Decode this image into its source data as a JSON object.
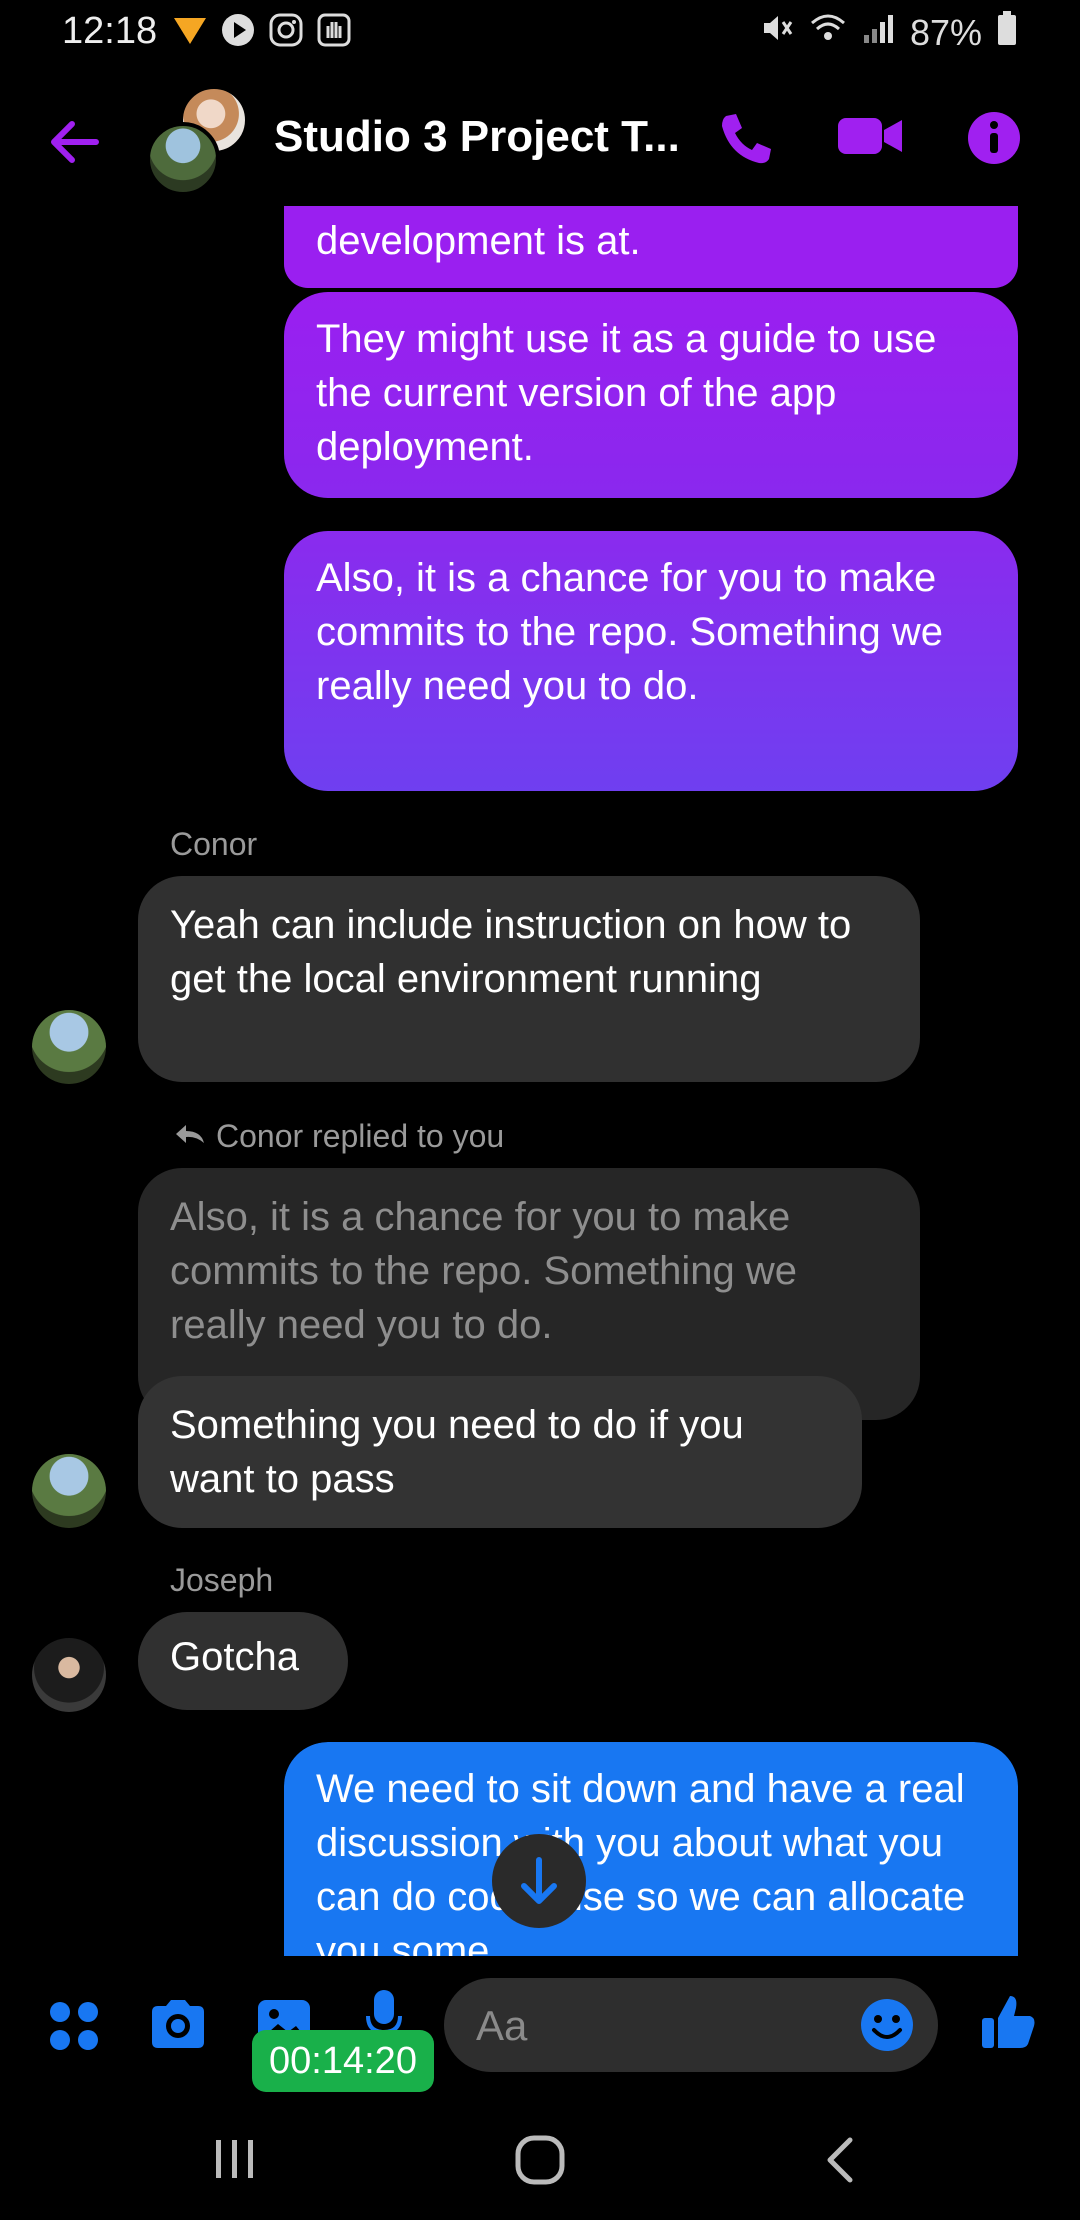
{
  "status_bar": {
    "time": "12:18",
    "battery": "87%"
  },
  "header": {
    "title": "Studio 3 Project T..."
  },
  "colors": {
    "accent_purple": "#9a1ff0",
    "accent_blue": "#1877f2",
    "received_bubble": "#303030",
    "timer_green": "#19b04a"
  },
  "messages": {
    "m1": "development is at.",
    "m2": "They might use it as a guide to use the current version of the app deployment.",
    "m3": "Also, it is a chance for you to make commits to the repo. Something we really need you to do.",
    "sender_conor": "Conor",
    "m4": "Yeah can include instruction on how to get the local environment running",
    "reply_label": "Conor replied to you",
    "quoted": "Also, it is a chance for you to make commits to the repo. Something we really need you to do.",
    "m5": "Something you need to do if you want to pass",
    "sender_joseph": "Joseph",
    "m6": "Gotcha",
    "m7": "We need to sit down and have a real discussion with you about what you can do code wise so we can allocate you some"
  },
  "composer": {
    "placeholder": "Aa",
    "timer": "00:14:20"
  },
  "icons": [
    "back-arrow-icon",
    "phone-icon",
    "video-icon",
    "info-icon",
    "apps-icon",
    "camera-icon",
    "gallery-icon",
    "mic-icon",
    "emoji-icon",
    "thumbs-up-icon",
    "scroll-down-icon"
  ]
}
